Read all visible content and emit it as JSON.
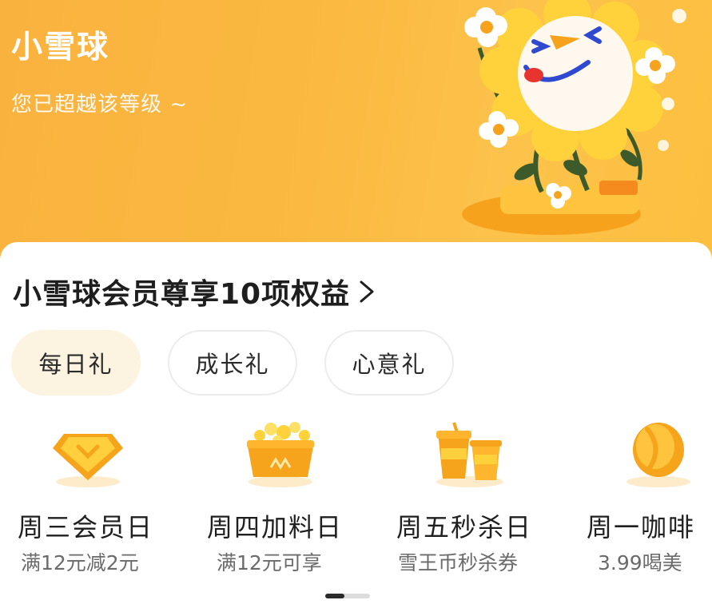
{
  "header": {
    "level_name": "小雪球",
    "level_status": "您已超越该等级 ~"
  },
  "benefits": {
    "title": "小雪球会员尊享10项权益"
  },
  "tabs": [
    {
      "label": "每日礼",
      "active": true
    },
    {
      "label": "成长礼",
      "active": false
    },
    {
      "label": "心意礼",
      "active": false
    }
  ],
  "items": [
    {
      "name": "周三会员日",
      "desc": "满12元减2元",
      "icon": "diamond-badge-icon"
    },
    {
      "name": "周四加料日",
      "desc": "满12元可享",
      "icon": "topping-basket-icon"
    },
    {
      "name": "周五秒杀日",
      "desc": "雪王币秒杀券",
      "icon": "drink-cups-icon"
    },
    {
      "name": "周一咖啡",
      "desc": "3.99喝美",
      "icon": "coffee-bean-icon"
    }
  ],
  "pager": {
    "current": 1,
    "total": 2
  },
  "colors": {
    "banner": "#fbb941",
    "accent": "#f6a41b",
    "active_tab_bg": "#fdf3e1"
  }
}
